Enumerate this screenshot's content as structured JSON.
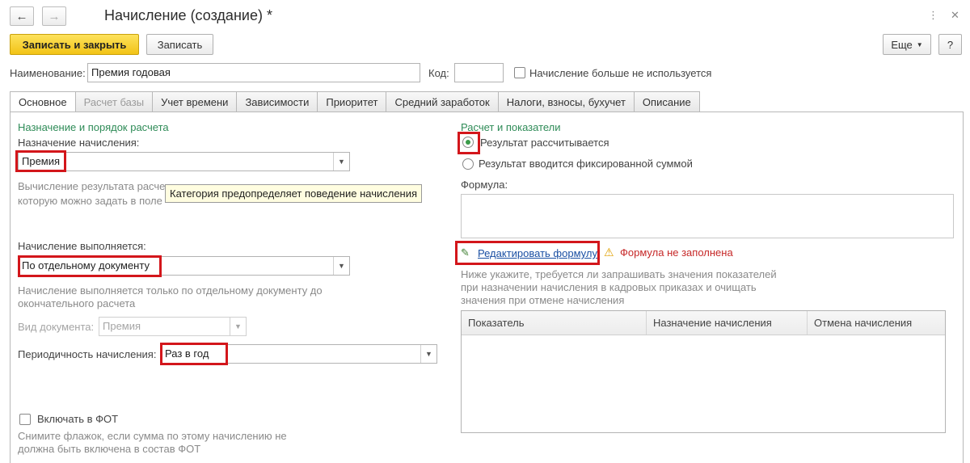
{
  "window": {
    "title": "Начисление (создание) *",
    "back_icon": "←",
    "forward_icon": "→",
    "more_icon": "⋮",
    "close_icon": "✕"
  },
  "toolbar": {
    "save_close_label": "Записать и закрыть",
    "save_label": "Записать",
    "more_label": "Еще",
    "help_label": "?"
  },
  "header": {
    "name_label": "Наименование:",
    "name_value": "Премия годовая",
    "code_label": "Код:",
    "code_value": "",
    "not_used_label": "Начисление больше не используется"
  },
  "tabs": [
    {
      "label": "Основное"
    },
    {
      "label": "Расчет базы"
    },
    {
      "label": "Учет времени"
    },
    {
      "label": "Зависимости"
    },
    {
      "label": "Приоритет"
    },
    {
      "label": "Средний заработок"
    },
    {
      "label": "Налоги, взносы, бухучет"
    },
    {
      "label": "Описание"
    }
  ],
  "left": {
    "group_title": "Назначение и порядок расчета",
    "purpose_label": "Назначение начисления:",
    "purpose_value": "Премия",
    "purpose_hint_1": "Вычисление результата расче",
    "purpose_hint_2": "которую можно задать в поле",
    "tooltip": "Категория предопределяет поведение начисления",
    "executed_label": "Начисление выполняется:",
    "executed_value": "По отдельному документу",
    "executed_hint_1": "Начисление выполняется только по отдельному документу до",
    "executed_hint_2": "окончательного расчета",
    "doc_type_label": "Вид документа:",
    "doc_type_value": "Премия",
    "periodicity_label": "Периодичность начисления:",
    "periodicity_value": "Раз в год",
    "include_fot_label": "Включать в ФОТ",
    "include_fot_hint_1": "Снимите флажок, если сумма по этому начислению не",
    "include_fot_hint_2": "должна быть включена в состав ФОТ"
  },
  "right": {
    "group_title": "Расчет и показатели",
    "radio_calculated": "Результат рассчитывается",
    "radio_fixed": "Результат вводится фиксированной суммой",
    "formula_label": "Формула:",
    "edit_formula_link": "Редактировать формулу",
    "warning_text": "Формула не заполнена",
    "hint_1": "Ниже укажите, требуется ли запрашивать значения показателей",
    "hint_2": "при назначении начисления в кадровых приказах и очищать",
    "hint_3": "значения при отмене начисления",
    "grid_columns": [
      "Показатель",
      "Назначение начисления",
      "Отмена начисления"
    ]
  },
  "colors": {
    "primary_button": "#f2c316",
    "group_title": "#2e8b57",
    "highlight_box": "#d3161b",
    "warning": "#c62828",
    "link": "#1a4fa3"
  }
}
